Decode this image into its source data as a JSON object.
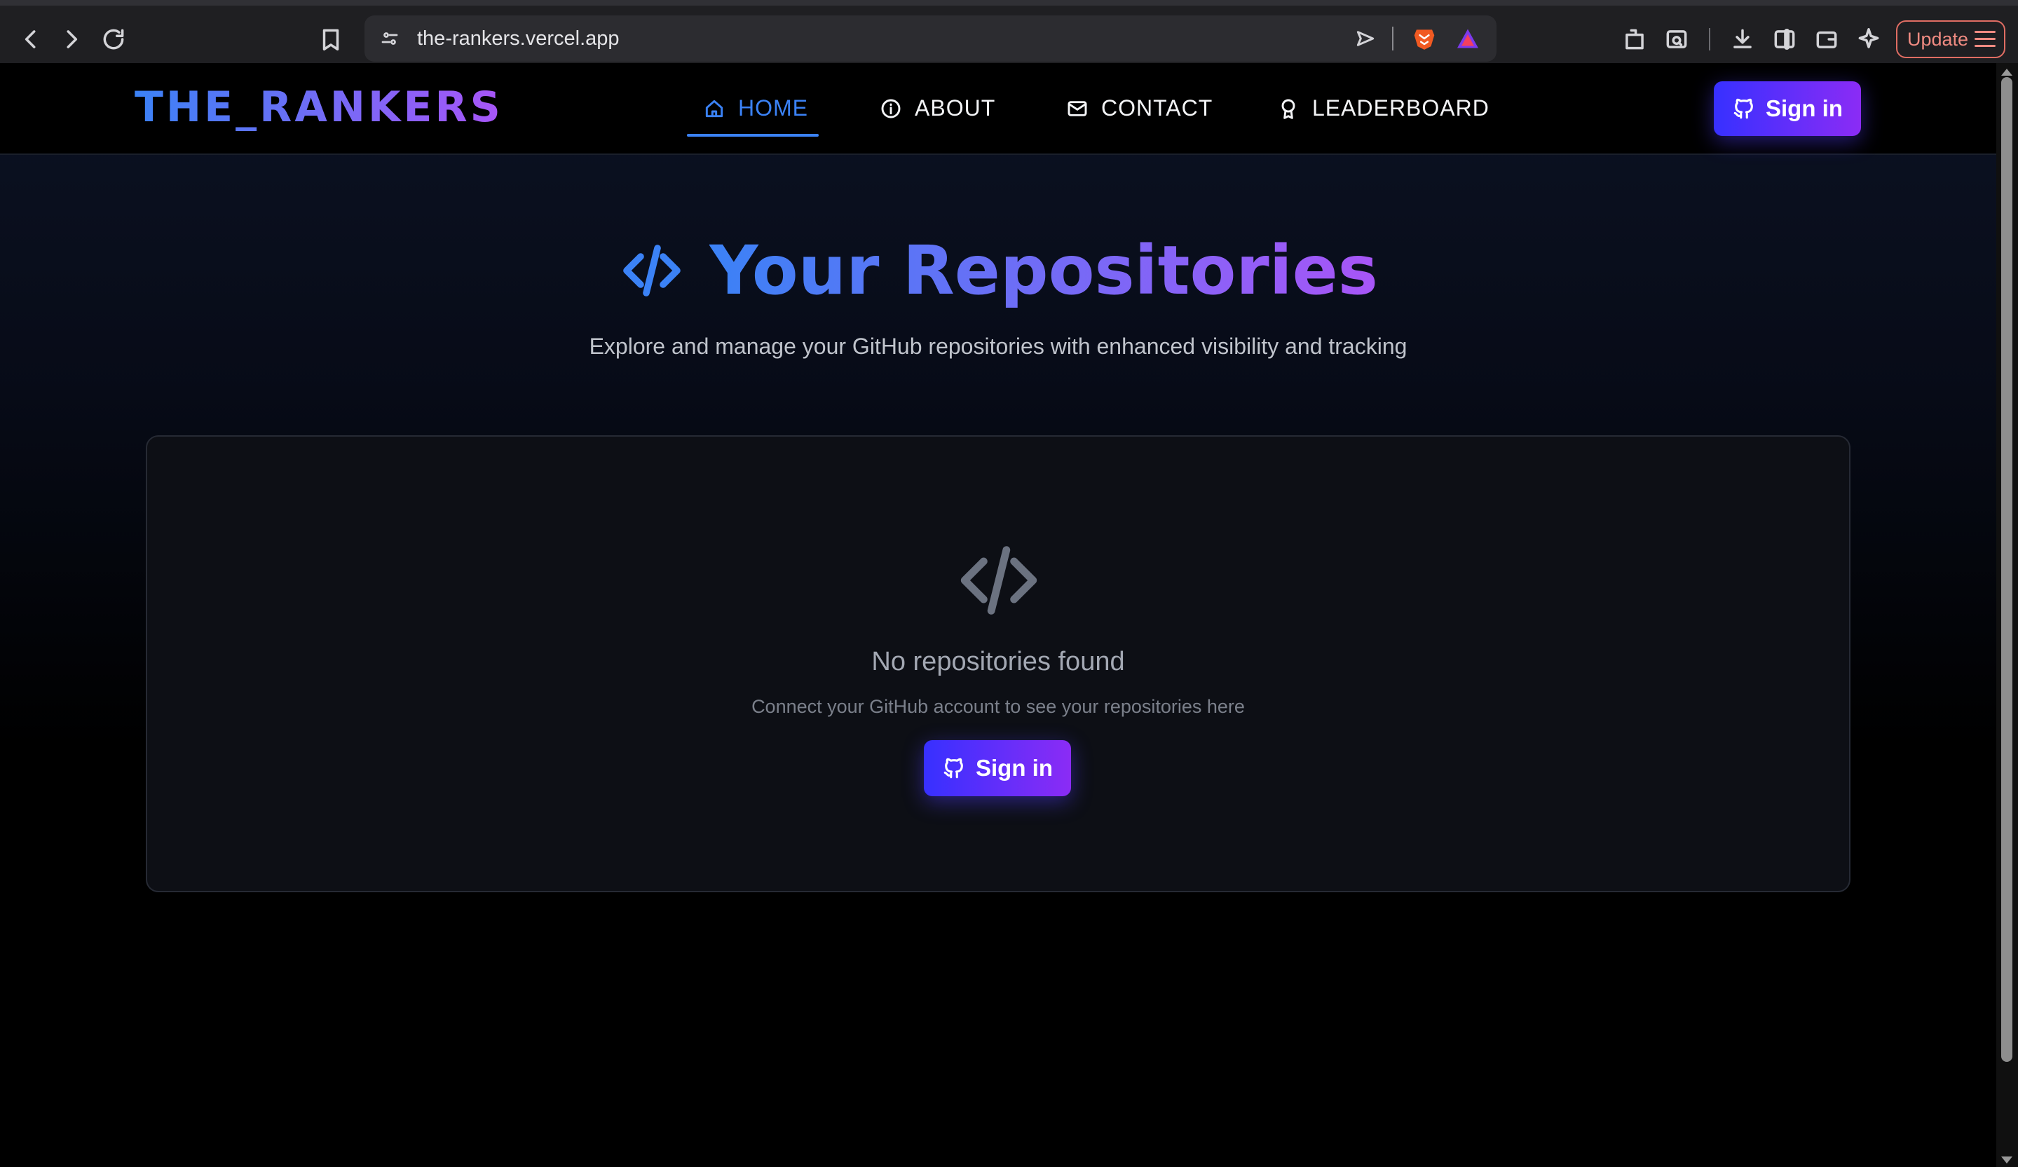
{
  "browser": {
    "url": "the-rankers.vercel.app",
    "update_label": "Update"
  },
  "nav": {
    "logo": "THE_RANKERS",
    "items": [
      {
        "label": "HOME",
        "icon": "home-icon",
        "active": true
      },
      {
        "label": "ABOUT",
        "icon": "info-icon",
        "active": false
      },
      {
        "label": "CONTACT",
        "icon": "mail-icon",
        "active": false
      },
      {
        "label": "LEADERBOARD",
        "icon": "award-icon",
        "active": false
      }
    ],
    "signin_label": "Sign in"
  },
  "hero": {
    "title": "Your Repositories",
    "subtitle": "Explore and manage your GitHub repositories with enhanced visibility and tracking"
  },
  "empty_state": {
    "title": "No repositories found",
    "description": "Connect your GitHub account to see your repositories here",
    "signin_label": "Sign in"
  },
  "colors": {
    "accent_blue": "#3b82f6",
    "accent_purple": "#a855f7",
    "button_start": "#3730ff",
    "button_end": "#8b2cf5"
  }
}
